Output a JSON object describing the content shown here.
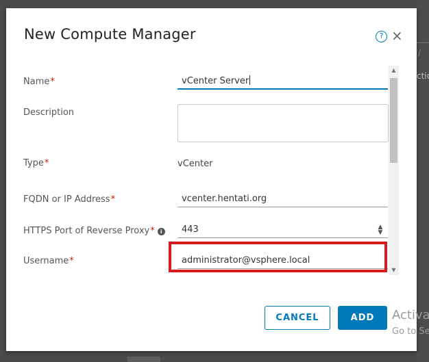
{
  "modal": {
    "title": "New Compute Manager",
    "help_icon": "?",
    "close_icon": "×"
  },
  "fields": {
    "name": {
      "label": "Name",
      "required": "*",
      "value": "vCenter Server"
    },
    "description": {
      "label": "Description",
      "value": ""
    },
    "type": {
      "label": "Type",
      "required": "*",
      "value": "vCenter"
    },
    "fqdn": {
      "label": "FQDN or IP Address",
      "required": "*",
      "value": "vcenter.hentati.org"
    },
    "https_port": {
      "label": "HTTPS Port of Reverse Proxy",
      "required": "*",
      "info_icon": "i",
      "value": "443",
      "stepper_up": "▲",
      "stepper_down": "▼"
    },
    "username": {
      "label": "Username",
      "required": "*",
      "value": "administrator@vsphere.local"
    }
  },
  "scrollbar": {
    "up_arrow": "▲",
    "down_arrow": "▼"
  },
  "buttons": {
    "cancel": "CANCEL",
    "add": "ADD"
  },
  "background": {
    "edge_text": "ctio",
    "edge_glyph": "/",
    "watermark_line1": "Activa",
    "watermark_line2": "Go to Se"
  },
  "colors": {
    "accent": "#0079b8",
    "required": "#c21d00",
    "highlight": "#d71920"
  }
}
